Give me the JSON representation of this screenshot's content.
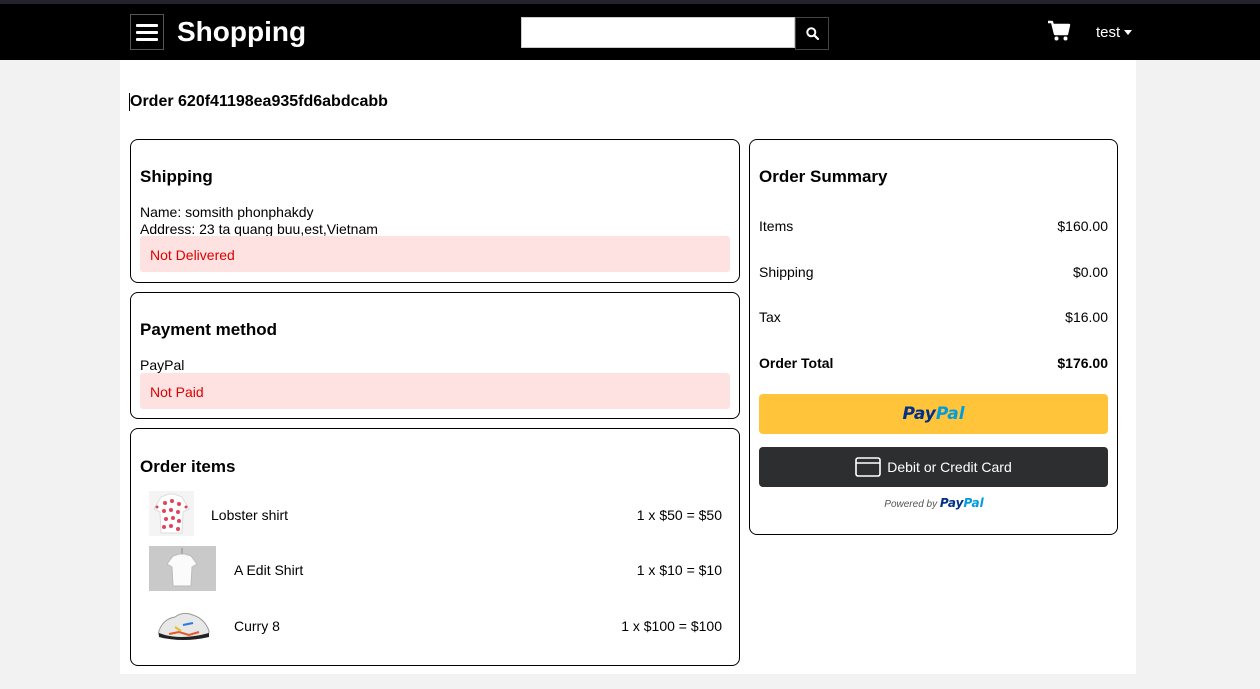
{
  "header": {
    "brand": "Shopping",
    "search_placeholder": "",
    "user_label": "test"
  },
  "order": {
    "title": "Order 620f41198ea935fd6abdcabb"
  },
  "shipping": {
    "heading": "Shipping",
    "name_line": "Name: somsith phonphakdy",
    "address_line": "Address: 23 ta quang buu,est,Vietnam",
    "status": "Not Delivered"
  },
  "payment": {
    "heading": "Payment method",
    "method": "PayPal",
    "status": "Not Paid"
  },
  "items": {
    "heading": "Order items",
    "list": [
      {
        "name": "Lobster shirt",
        "price": "1 x $50 = $50"
      },
      {
        "name": "A Edit Shirt",
        "price": "1 x $10 = $10"
      },
      {
        "name": "Curry 8",
        "price": "1 x $100 = $100"
      }
    ]
  },
  "summary": {
    "heading": "Order Summary",
    "rows": [
      {
        "label": "Items",
        "value": "$160.00"
      },
      {
        "label": "Shipping",
        "value": "$0.00"
      },
      {
        "label": "Tax",
        "value": "$16.00"
      },
      {
        "label": "Order Total",
        "value": "$176.00"
      }
    ],
    "paypal_pay": "Pay",
    "paypal_pal": "Pal",
    "card_button": "Debit or Credit Card",
    "powered_by": "Powered by"
  },
  "colors": {
    "header_bg": "#000000",
    "alert_bg": "#fee2e2",
    "alert_text": "#dd0000",
    "paypal_yellow": "#ffc439",
    "card_button_bg": "#2c2e2f"
  }
}
